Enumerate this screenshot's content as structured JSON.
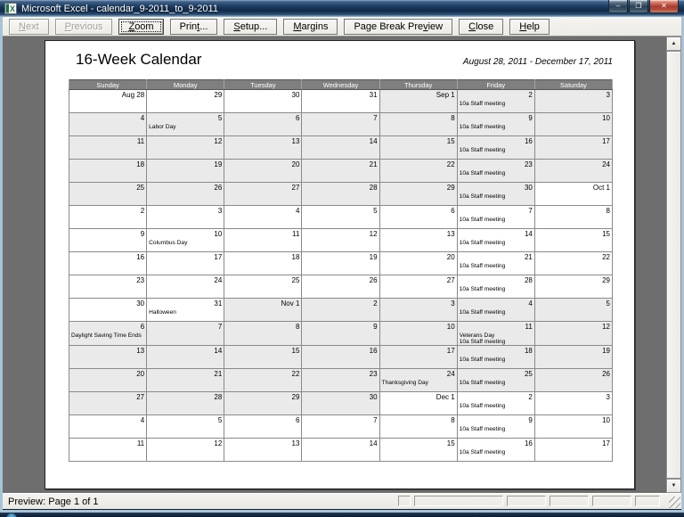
{
  "window": {
    "title": "Microsoft Excel - calendar_9-2011_to_9-2011",
    "controls": {
      "minimize": {
        "glyph": "–"
      },
      "maximize": {
        "glyph": "❐"
      },
      "close": {
        "glyph": "✕"
      }
    }
  },
  "toolbar": {
    "buttons": [
      {
        "label": "Next",
        "mnemonic": 0,
        "disabled": true
      },
      {
        "label": "Previous",
        "mnemonic": 0,
        "disabled": true
      },
      {
        "label": "Zoom",
        "mnemonic": 0,
        "focused": true
      },
      {
        "label": "Print...",
        "mnemonic": 4
      },
      {
        "label": "Setup...",
        "mnemonic": 0
      },
      {
        "label": "Margins",
        "mnemonic": 0
      },
      {
        "label": "Page Break Preview",
        "mnemonic": 14
      },
      {
        "label": "Close",
        "mnemonic": 0
      },
      {
        "label": "Help",
        "mnemonic": 0
      }
    ]
  },
  "preview": {
    "calendar_title": "16-Week Calendar",
    "date_range": "August 28, 2011 - December 17, 2011",
    "day_headers": [
      "Sunday",
      "Monday",
      "Tuesday",
      "Wednesday",
      "Thursday",
      "Friday",
      "Saturday"
    ],
    "weeks": [
      [
        {
          "d": "Aug 28",
          "s": false
        },
        {
          "d": "29",
          "s": false
        },
        {
          "d": "30",
          "s": false
        },
        {
          "d": "31",
          "s": false
        },
        {
          "d": "Sep 1",
          "s": true
        },
        {
          "d": "2",
          "s": true,
          "e": [
            "10a Staff meeting"
          ]
        },
        {
          "d": "3",
          "s": true
        }
      ],
      [
        {
          "d": "4",
          "s": true
        },
        {
          "d": "5",
          "s": true,
          "e": [
            "Labor Day"
          ]
        },
        {
          "d": "6",
          "s": true
        },
        {
          "d": "7",
          "s": true
        },
        {
          "d": "8",
          "s": true
        },
        {
          "d": "9",
          "s": true,
          "e": [
            "10a Staff meeting"
          ]
        },
        {
          "d": "10",
          "s": true
        }
      ],
      [
        {
          "d": "11",
          "s": true
        },
        {
          "d": "12",
          "s": true
        },
        {
          "d": "13",
          "s": true
        },
        {
          "d": "14",
          "s": true
        },
        {
          "d": "15",
          "s": true
        },
        {
          "d": "16",
          "s": true,
          "e": [
            "10a Staff meeting"
          ]
        },
        {
          "d": "17",
          "s": true
        }
      ],
      [
        {
          "d": "18",
          "s": true
        },
        {
          "d": "19",
          "s": true
        },
        {
          "d": "20",
          "s": true
        },
        {
          "d": "21",
          "s": true
        },
        {
          "d": "22",
          "s": true
        },
        {
          "d": "23",
          "s": true,
          "e": [
            "10a Staff meeting"
          ]
        },
        {
          "d": "24",
          "s": true
        }
      ],
      [
        {
          "d": "25",
          "s": true
        },
        {
          "d": "26",
          "s": true
        },
        {
          "d": "27",
          "s": true
        },
        {
          "d": "28",
          "s": true
        },
        {
          "d": "29",
          "s": true
        },
        {
          "d": "30",
          "s": true,
          "e": [
            "10a Staff meeting"
          ]
        },
        {
          "d": "Oct 1",
          "s": false
        }
      ],
      [
        {
          "d": "2",
          "s": false
        },
        {
          "d": "3",
          "s": false
        },
        {
          "d": "4",
          "s": false
        },
        {
          "d": "5",
          "s": false
        },
        {
          "d": "6",
          "s": false
        },
        {
          "d": "7",
          "s": false,
          "e": [
            "10a Staff meeting"
          ]
        },
        {
          "d": "8",
          "s": false
        }
      ],
      [
        {
          "d": "9",
          "s": false
        },
        {
          "d": "10",
          "s": false,
          "e": [
            "Columbus Day"
          ]
        },
        {
          "d": "11",
          "s": false
        },
        {
          "d": "12",
          "s": false
        },
        {
          "d": "13",
          "s": false
        },
        {
          "d": "14",
          "s": false,
          "e": [
            "10a Staff meeting"
          ]
        },
        {
          "d": "15",
          "s": false
        }
      ],
      [
        {
          "d": "16",
          "s": false
        },
        {
          "d": "17",
          "s": false
        },
        {
          "d": "18",
          "s": false
        },
        {
          "d": "19",
          "s": false
        },
        {
          "d": "20",
          "s": false
        },
        {
          "d": "21",
          "s": false,
          "e": [
            "10a Staff meeting"
          ]
        },
        {
          "d": "22",
          "s": false
        }
      ],
      [
        {
          "d": "23",
          "s": false
        },
        {
          "d": "24",
          "s": false
        },
        {
          "d": "25",
          "s": false
        },
        {
          "d": "26",
          "s": false
        },
        {
          "d": "27",
          "s": false
        },
        {
          "d": "28",
          "s": false,
          "e": [
            "10a Staff meeting"
          ]
        },
        {
          "d": "29",
          "s": false
        }
      ],
      [
        {
          "d": "30",
          "s": false
        },
        {
          "d": "31",
          "s": false,
          "e": [
            "Halloween"
          ]
        },
        {
          "d": "Nov 1",
          "s": true
        },
        {
          "d": "2",
          "s": true
        },
        {
          "d": "3",
          "s": true
        },
        {
          "d": "4",
          "s": true,
          "e": [
            "10a Staff meeting"
          ]
        },
        {
          "d": "5",
          "s": true
        }
      ],
      [
        {
          "d": "6",
          "s": true,
          "e": [
            "Daylight Saving Time Ends"
          ]
        },
        {
          "d": "7",
          "s": true
        },
        {
          "d": "8",
          "s": true
        },
        {
          "d": "9",
          "s": true
        },
        {
          "d": "10",
          "s": true
        },
        {
          "d": "11",
          "s": true,
          "e": [
            "Veterans Day",
            "10a Staff meeting"
          ]
        },
        {
          "d": "12",
          "s": true
        }
      ],
      [
        {
          "d": "13",
          "s": true
        },
        {
          "d": "14",
          "s": true
        },
        {
          "d": "15",
          "s": true
        },
        {
          "d": "16",
          "s": true
        },
        {
          "d": "17",
          "s": true
        },
        {
          "d": "18",
          "s": true,
          "e": [
            "10a Staff meeting"
          ]
        },
        {
          "d": "19",
          "s": true
        }
      ],
      [
        {
          "d": "20",
          "s": true
        },
        {
          "d": "21",
          "s": true
        },
        {
          "d": "22",
          "s": true
        },
        {
          "d": "23",
          "s": true
        },
        {
          "d": "24",
          "s": true,
          "e": [
            "Thanksgiving Day"
          ]
        },
        {
          "d": "25",
          "s": true,
          "e": [
            "10a Staff meeting"
          ]
        },
        {
          "d": "26",
          "s": true
        }
      ],
      [
        {
          "d": "27",
          "s": true
        },
        {
          "d": "28",
          "s": true
        },
        {
          "d": "29",
          "s": true
        },
        {
          "d": "30",
          "s": true
        },
        {
          "d": "Dec 1",
          "s": false
        },
        {
          "d": "2",
          "s": false,
          "e": [
            "10a Staff meeting"
          ]
        },
        {
          "d": "3",
          "s": false
        }
      ],
      [
        {
          "d": "4",
          "s": false
        },
        {
          "d": "5",
          "s": false
        },
        {
          "d": "6",
          "s": false
        },
        {
          "d": "7",
          "s": false
        },
        {
          "d": "8",
          "s": false
        },
        {
          "d": "9",
          "s": false,
          "e": [
            "10a Staff meeting"
          ]
        },
        {
          "d": "10",
          "s": false
        }
      ],
      [
        {
          "d": "11",
          "s": false
        },
        {
          "d": "12",
          "s": false
        },
        {
          "d": "13",
          "s": false
        },
        {
          "d": "14",
          "s": false
        },
        {
          "d": "15",
          "s": false
        },
        {
          "d": "16",
          "s": false,
          "e": [
            "10a Staff meeting"
          ]
        },
        {
          "d": "17",
          "s": false
        }
      ]
    ]
  },
  "scrollbar": {
    "up_glyph": "▲",
    "down_glyph": "▼"
  },
  "status_bar": {
    "message": "Preview: Page 1 of 1"
  },
  "colors": {
    "header_bg": "#7f7f7f",
    "shaded_cell": "#eaeaea",
    "titlebar_dark": "#102a49",
    "close_button_red": "#a83c32",
    "preview_background": "#6e6e6e"
  }
}
